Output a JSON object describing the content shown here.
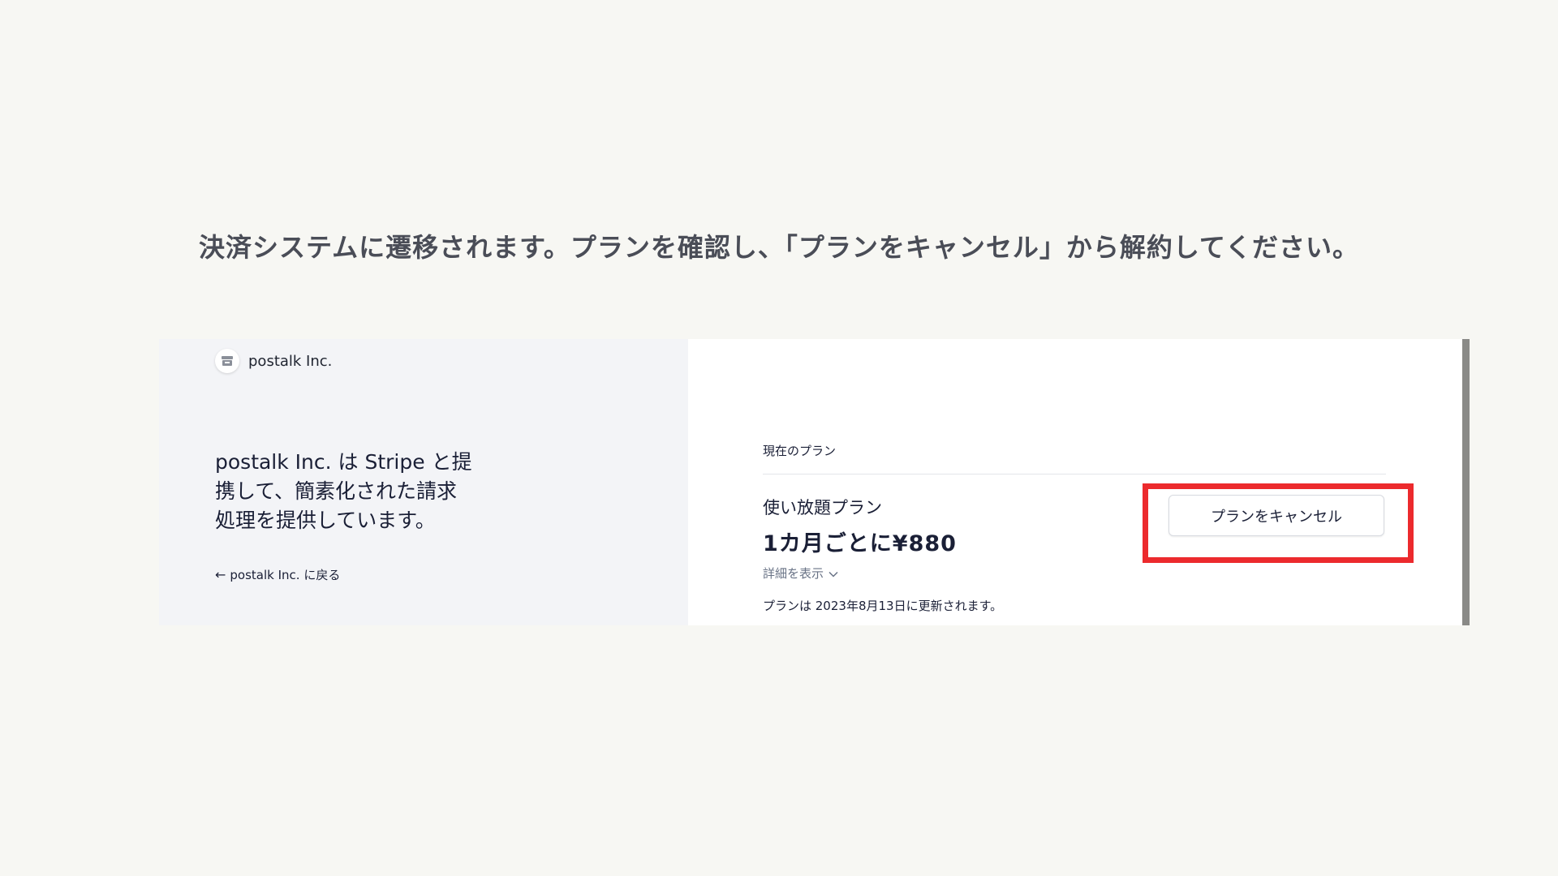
{
  "instruction": "決済システムに遷移されます。プランを確認し、「プランをキャンセル」から解約してください。",
  "left_panel": {
    "brand_name": "postalk Inc.",
    "brand_icon": "store-icon",
    "headline_line1": "postalk Inc. は Stripe と提",
    "headline_line2": "携して、簡素化された請求",
    "headline_line3": "処理を提供しています。",
    "back_link_arrow": "←",
    "back_link_label": "postalk Inc. に戻る"
  },
  "right_panel": {
    "section_label": "現在のプラン",
    "plan_name": "使い放題プラン",
    "plan_price": "1カ月ごとに¥880",
    "details_toggle": "詳細を表示",
    "renew_note": "プランは 2023年8月13日に更新されます。",
    "cancel_button_label": "プランをキャンセル"
  },
  "colors": {
    "highlight": "#ec2a2d",
    "left_bg": "#f3f4f7",
    "page_bg": "#f7f7f3"
  }
}
